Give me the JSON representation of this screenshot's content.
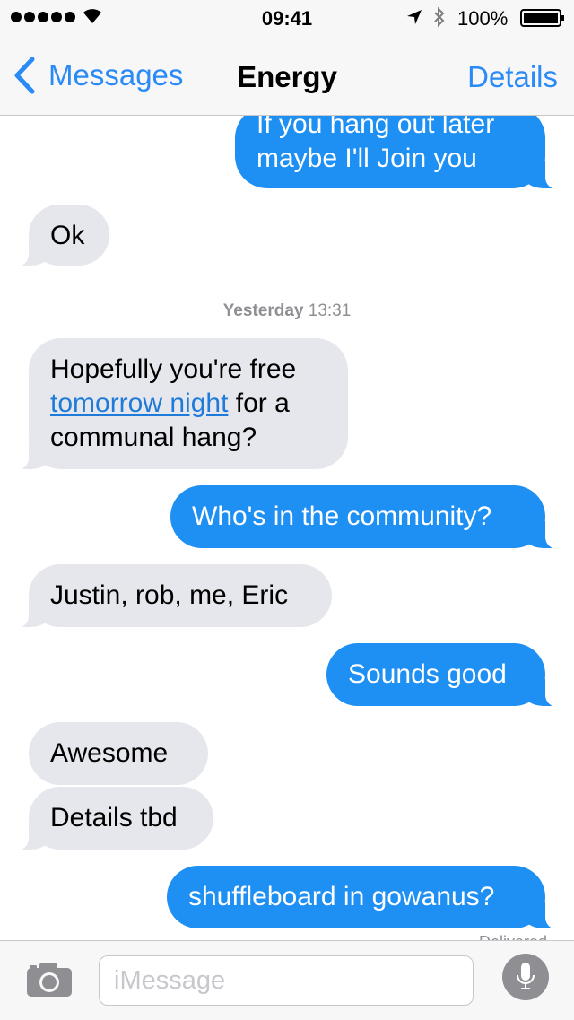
{
  "status_bar": {
    "time": "09:41",
    "battery_percent": "100%",
    "signal_bars": 5,
    "icons": [
      "signal-dots",
      "wifi-icon",
      "location-arrow-icon",
      "bluetooth-icon",
      "battery-icon"
    ]
  },
  "nav": {
    "back_label": "Messages",
    "title": "Energy",
    "details_label": "Details"
  },
  "timestamp": {
    "day": "Yesterday",
    "time": "13:31"
  },
  "messages": [
    {
      "direction": "out",
      "text": "If you hang out later\nmaybe I'll Join you"
    },
    {
      "direction": "in",
      "text": "Ok"
    },
    {
      "direction": "in",
      "text_before": "Hopefully you're free",
      "link": "tomorrow night",
      "text_after_link": " for a",
      "text_line3": "communal hang?"
    },
    {
      "direction": "out",
      "text": "Who's in the community?"
    },
    {
      "direction": "in",
      "text": "Justin, rob, me, Eric"
    },
    {
      "direction": "out",
      "text": "Sounds good"
    },
    {
      "direction": "in",
      "text": "Awesome"
    },
    {
      "direction": "in",
      "text": "Details tbd"
    },
    {
      "direction": "out",
      "text": "shuffleboard in gowanus?"
    }
  ],
  "delivered_label": "Delivered",
  "input": {
    "placeholder": "iMessage",
    "value": ""
  },
  "colors": {
    "accent": "#2a8af6",
    "outgoing_bubble": "#1e8ff3",
    "incoming_bubble": "#e6e7ec",
    "bar_background": "#f7f7f8",
    "secondary_text": "#8e8e93"
  }
}
